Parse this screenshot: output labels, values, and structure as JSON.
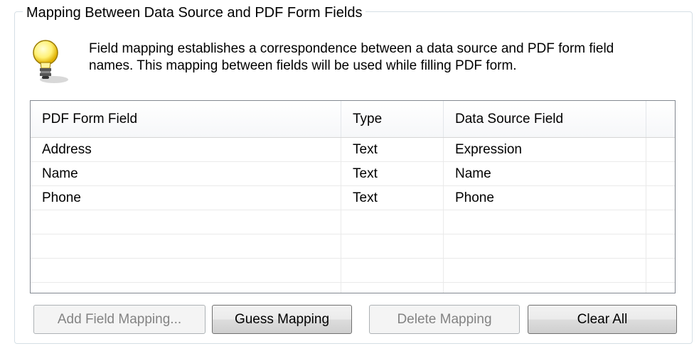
{
  "group": {
    "title": "Mapping Between Data Source and PDF Form Fields"
  },
  "hint": {
    "icon": "lightbulb-icon",
    "line1": "Field mapping establishes a correspondence between a data source and PDF form field",
    "line2": "names. This mapping between fields will be used while filling PDF form."
  },
  "table": {
    "columns": [
      "PDF Form Field",
      "Type",
      "Data Source Field"
    ],
    "rows": [
      [
        "Address",
        "Text",
        "Expression"
      ],
      [
        "Name",
        "Text",
        "Name"
      ],
      [
        "Phone",
        "Text",
        "Phone"
      ]
    ]
  },
  "buttons": {
    "add": "Add Field Mapping...",
    "guess": "Guess Mapping",
    "delete": "Delete Mapping",
    "clear": "Clear All"
  }
}
